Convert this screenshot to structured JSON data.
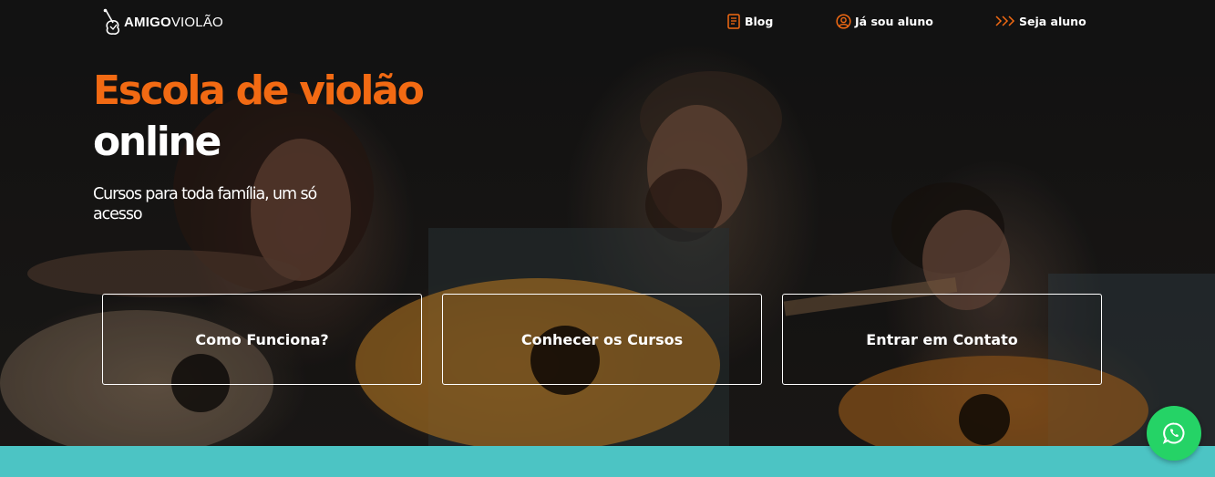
{
  "brand": {
    "logo_bold": "AMIGO",
    "logo_light": "VIOLÃO"
  },
  "nav": {
    "items": [
      {
        "label": "Blog",
        "icon": "document-icon"
      },
      {
        "label": "Já sou aluno",
        "icon": "user-circle-icon"
      },
      {
        "label": "Seja aluno",
        "icon": "chevrons-right-icon"
      }
    ]
  },
  "hero": {
    "title_line1": "Escola de violão",
    "title_line2": "online",
    "subtitle": "Cursos para toda família, um só acesso"
  },
  "actions": [
    {
      "label": "Como Funciona?"
    },
    {
      "label": "Conhecer os Cursos"
    },
    {
      "label": "Entrar em Contato"
    }
  ],
  "floating": {
    "icon": "whatsapp-icon"
  },
  "colors": {
    "accent": "#f26a13",
    "teal": "#4cc4c4",
    "whatsapp": "#25d366",
    "background": "#1c1c1c"
  }
}
